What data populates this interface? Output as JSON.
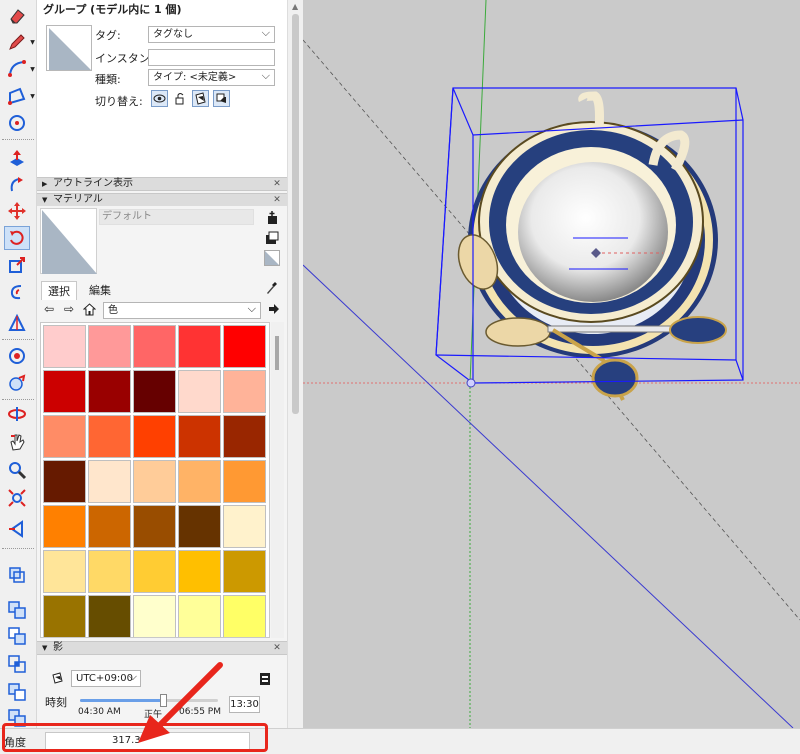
{
  "entity_info": {
    "title": "グループ (モデル内に 1 個)",
    "tag_label": "タグ:",
    "tag_value": "タグなし",
    "instance_label": "インスタンス:",
    "instance_value": "",
    "type_label": "種類:",
    "type_value": "タイプ: <未定義>",
    "toggle_label": "切り替え:"
  },
  "trays": {
    "outliner": "アウトライン表示",
    "materials": "マテリアル",
    "shadows": "影"
  },
  "materials": {
    "current_name": "デフォルト",
    "tabs": [
      "選択",
      "編集"
    ],
    "library": "色",
    "swatch_colors": [
      "#ffcccc",
      "#ff9999",
      "#ff6666",
      "#ff3333",
      "#ff0000",
      "#cc0000",
      "#990000",
      "#660000",
      "#ffd9cc",
      "#ffb399",
      "#ff8c66",
      "#ff6633",
      "#ff4000",
      "#cc3300",
      "#992600",
      "#661a00",
      "#ffe6cc",
      "#ffcc99",
      "#ffb366",
      "#ff9933",
      "#ff8000",
      "#cc6600",
      "#994d00",
      "#663300",
      "#fff2cc",
      "#ffe599",
      "#ffd966",
      "#ffcc33",
      "#ffbf00",
      "#cc9900",
      "#997300",
      "#664d00",
      "#ffffcc",
      "#ffff99",
      "#ffff66"
    ]
  },
  "shadows": {
    "utc": "UTC+09:00",
    "time_label": "時刻",
    "time_start": "04:30 AM",
    "time_noon": "正午",
    "time_end": "06:55 PM",
    "time_value": "13:30",
    "time_fraction": 0.6
  },
  "status_bar": {
    "angle_label": "角度",
    "angle_value": "317.3"
  },
  "colors": {
    "accent_blue": "#1f5fd8",
    "highlight_red": "#e8261c",
    "bounding_box": "#1a1aff"
  },
  "toolbar": {
    "icons": [
      "eraser-icon",
      "pencil-icon",
      "arc-icon",
      "rectangle-icon",
      "circle-icon",
      "push-pull-icon",
      "follow-me-icon",
      "move-icon",
      "rotate-icon",
      "scale-icon",
      "offset-icon",
      "tape-measure-icon",
      "protractor-icon",
      "paint-bucket-icon",
      "orbit-icon",
      "pan-icon",
      "zoom-icon",
      "zoom-extents-icon",
      "section-plane-icon"
    ]
  }
}
